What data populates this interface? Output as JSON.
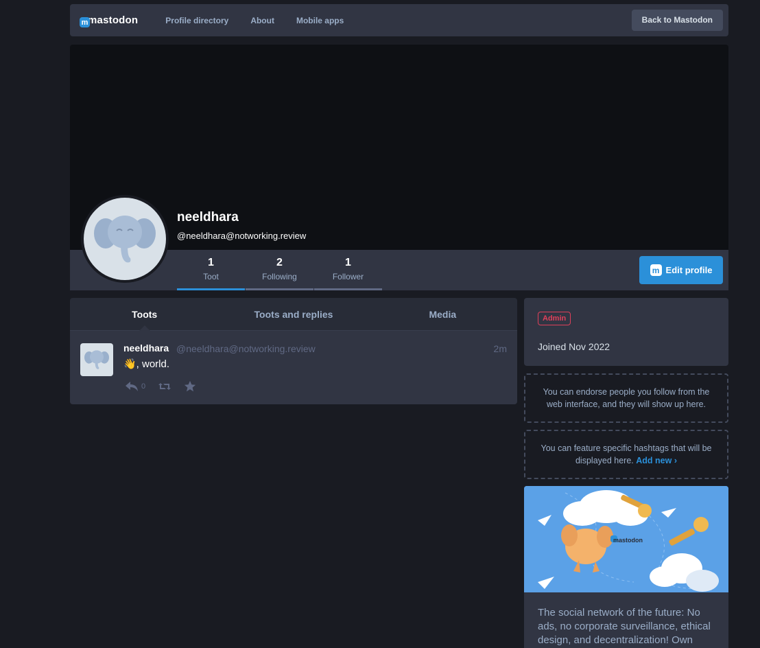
{
  "nav": {
    "logo_text": "mastodon",
    "links": [
      "Profile directory",
      "About",
      "Mobile apps"
    ],
    "back_button": "Back to Mastodon"
  },
  "profile": {
    "display_name": "neeldhara",
    "acct": "@neeldhara@notworking.review",
    "counters": [
      {
        "num": "1",
        "label": "Toot"
      },
      {
        "num": "2",
        "label": "Following"
      },
      {
        "num": "1",
        "label": "Follower"
      }
    ],
    "edit_button": "Edit profile"
  },
  "tabs": [
    "Toots",
    "Toots and replies",
    "Media"
  ],
  "status": {
    "name": "neeldhara",
    "acct": "@neeldhara@notworking.review",
    "time": "2m",
    "content": "👋, world.",
    "reply_count": "0"
  },
  "sidebar": {
    "badge": "Admin",
    "joined": "Joined Nov 2022",
    "endorse_text": "You can endorse people you follow from the web interface, and they will show up here.",
    "hashtags_text": "You can feature specific hashtags that will be displayed here.",
    "add_new": "Add new",
    "promo_logo": "mastodon",
    "about_text": "The social network of the future: No ads, no corporate surveillance, ethical design, and decentralization! Own your"
  },
  "colors": {
    "accent": "#2b90d9",
    "background": "#191b22",
    "admin": "#df405a"
  }
}
